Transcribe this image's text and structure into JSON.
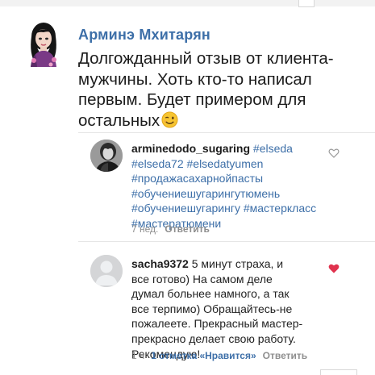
{
  "post": {
    "author": "Арминэ Мхитарян",
    "text": "Долгожданный отзыв от клиента-\nмужчины. Хоть кто-то написал\nпервым. Будет примером для\nостальных",
    "emoji": "wink-emoji"
  },
  "comments": [
    {
      "username": "arminedodo_sugaring",
      "line1_tag": "#elseda",
      "line2": "#elseda72 #elsedatyumen",
      "line3": "#продажасахарнойпасты",
      "line4": "#обучениешугарингутюмень",
      "line5": "#обучениешугарингу #мастеркласс",
      "line6": "#мастератюмени",
      "time": "7 нед.",
      "reply": "Ответить",
      "liked": false
    },
    {
      "username": "sacha9372",
      "text": "5 минут страха, и\nвсе готово) На самом деле\nдумал больнее  намного, а так\nвсе терпимо) Обращайтесь-не\nпожалеете. Прекрасный мастер-\nпрекрасно делает свою работу.\nРекомендую!",
      "time": "1 ч",
      "likes": "1 отметка «Нравится»",
      "reply": "Ответить",
      "liked": true
    }
  ],
  "icons": {
    "heart_outline": "heart-outline-icon",
    "heart_filled": "heart-filled-icon"
  },
  "colors": {
    "link_blue": "#3d6fa8",
    "heart_red": "#e0334e",
    "meta_gray": "#8e8e8e"
  }
}
